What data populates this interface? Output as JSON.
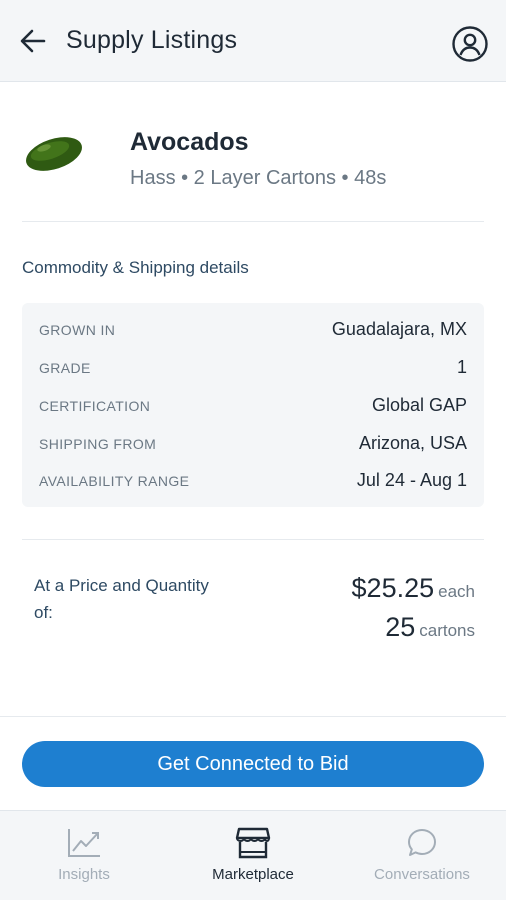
{
  "header": {
    "title": "Supply Listings",
    "back_icon": "arrow-left-icon",
    "profile_icon": "user-circle-icon"
  },
  "product": {
    "name": "Avocados",
    "subtitle": "Hass • 2 Layer Cartons • 48s",
    "image_icon": "avocado-icon"
  },
  "details": {
    "section_title": "Commodity & Shipping details",
    "rows": [
      {
        "label": "GROWN IN",
        "value": "Guadalajara, MX"
      },
      {
        "label": "GRADE",
        "value": "1"
      },
      {
        "label": "CERTIFICATION",
        "value": "Global GAP"
      },
      {
        "label": "SHIPPING FROM",
        "value": "Arizona, USA"
      },
      {
        "label": "AVAILABILITY RANGE",
        "value": "Jul 24 - Aug 1"
      }
    ]
  },
  "pricing": {
    "label": "At a Price and Quantity of:",
    "price": "$25.25",
    "price_unit": "each",
    "quantity": "25",
    "quantity_unit": "cartons"
  },
  "cta": {
    "label": "Get Connected to Bid",
    "color": "#1e7fd0"
  },
  "tabs": [
    {
      "label": "Insights",
      "icon": "chart-line-icon",
      "active": false
    },
    {
      "label": "Marketplace",
      "icon": "storefront-icon",
      "active": true
    },
    {
      "label": "Conversations",
      "icon": "chat-bubble-icon",
      "active": false
    }
  ]
}
